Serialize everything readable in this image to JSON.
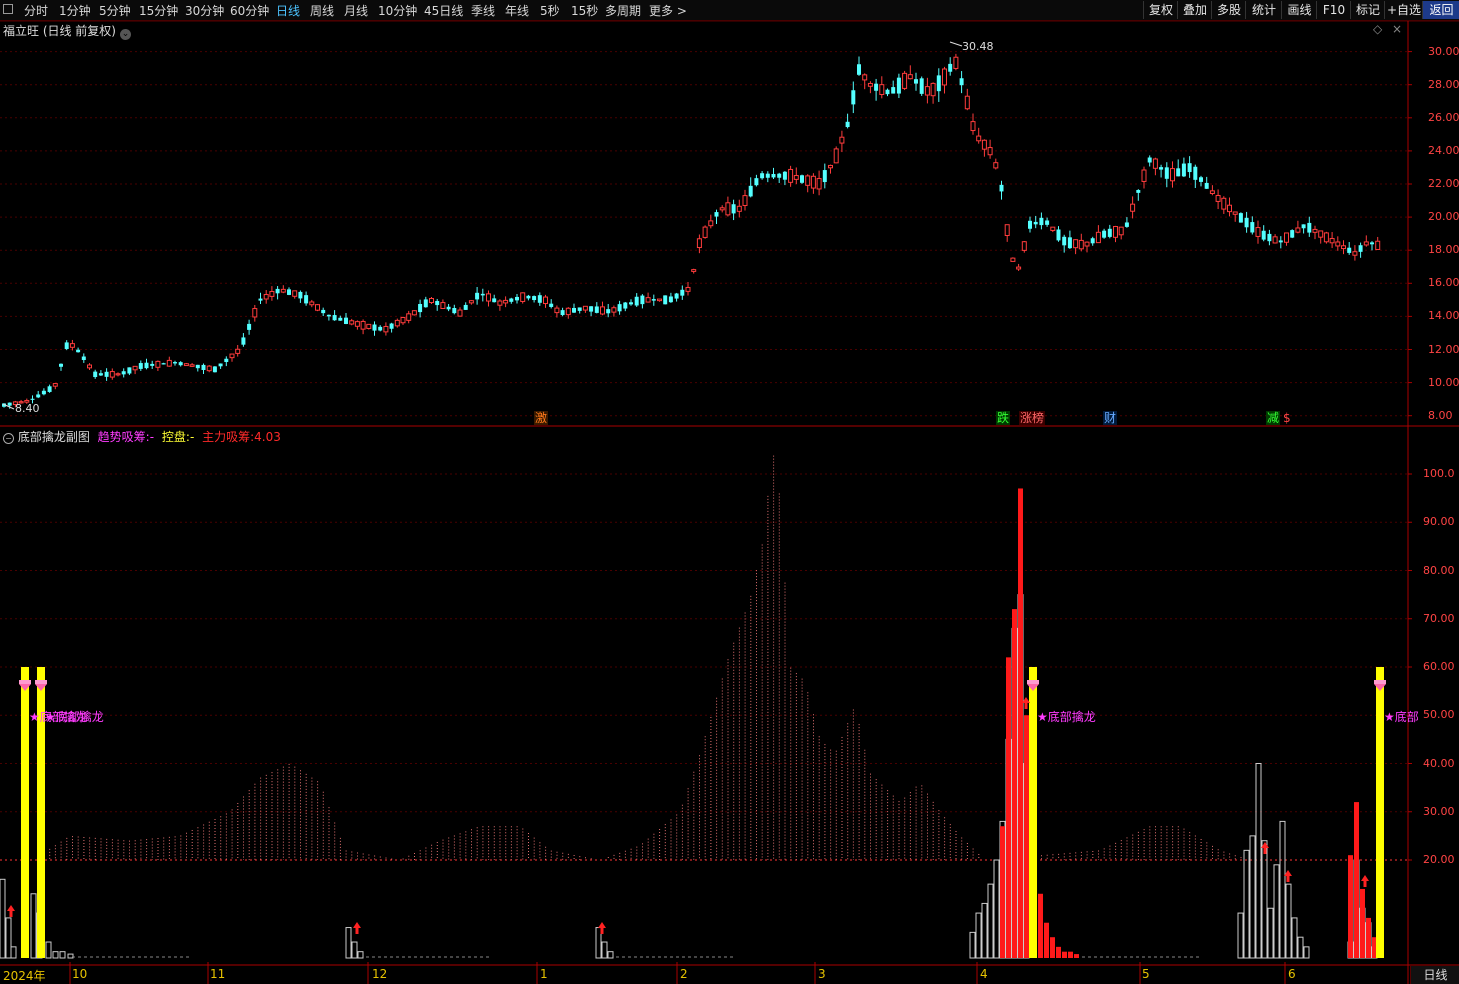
{
  "toolbar": {
    "periods": [
      "分时",
      "1分钟",
      "5分钟",
      "15分钟",
      "30分钟",
      "60分钟",
      "日线",
      "周线",
      "月线",
      "10分钟",
      "45日线",
      "季线",
      "年线",
      "5秒",
      "15秒",
      "多周期",
      "更多 >"
    ],
    "active_period": "日线",
    "right_buttons": [
      "复权",
      "叠加",
      "多股",
      "统计",
      "画线",
      "F10",
      "标记",
      "+自选",
      "返回"
    ],
    "active_right": "返回"
  },
  "main_chart": {
    "title": "福立旺 (日线 前复权)",
    "high_label": "30.48",
    "low_label": "8.40",
    "y_ticks": [
      "30.00",
      "28.00",
      "26.00",
      "24.00",
      "22.00",
      "20.00",
      "18.00",
      "16.00",
      "14.00",
      "12.00",
      "10.00",
      "8.00"
    ],
    "tags": [
      {
        "text": "激",
        "color": "#ff7a1a"
      },
      {
        "text": "跌",
        "color": "#33ff33"
      },
      {
        "text": "涨榜",
        "color": "#ff6666"
      },
      {
        "text": "财",
        "color": "#66aaff"
      },
      {
        "text": "减",
        "color": "#33ff33"
      },
      {
        "text": "$",
        "color": "#ff4444"
      }
    ]
  },
  "sub_chart": {
    "name": "底部擒龙副图",
    "indicators": [
      {
        "label": "趋势吸筹:",
        "value": "-",
        "color": "#ff3cff"
      },
      {
        "label": "控盘:",
        "value": "-",
        "color": "#ffff33"
      },
      {
        "label": "主力吸筹:",
        "value": "4.03",
        "color": "#ff2a2a"
      }
    ],
    "y_ticks": [
      "100.0",
      "90.00",
      "80.00",
      "70.00",
      "60.00",
      "50.00",
      "40.00",
      "30.00",
      "20.00"
    ],
    "signal_label": "★底部擒龙",
    "signal_label_overlap": "★底部擒龙",
    "signal_label_cut": "★底部"
  },
  "x_axis": {
    "labels": [
      "2024年",
      "10",
      "11",
      "12",
      "1",
      "2",
      "3",
      "4",
      "5",
      "6"
    ]
  },
  "status": {
    "period": "日线"
  },
  "colors": {
    "up": "#ff3c3c",
    "down": "#54ffff",
    "grid": "#5a0000",
    "axis": "#ff3333",
    "signal": "#ffff00",
    "accent": "#ff3cff"
  }
}
